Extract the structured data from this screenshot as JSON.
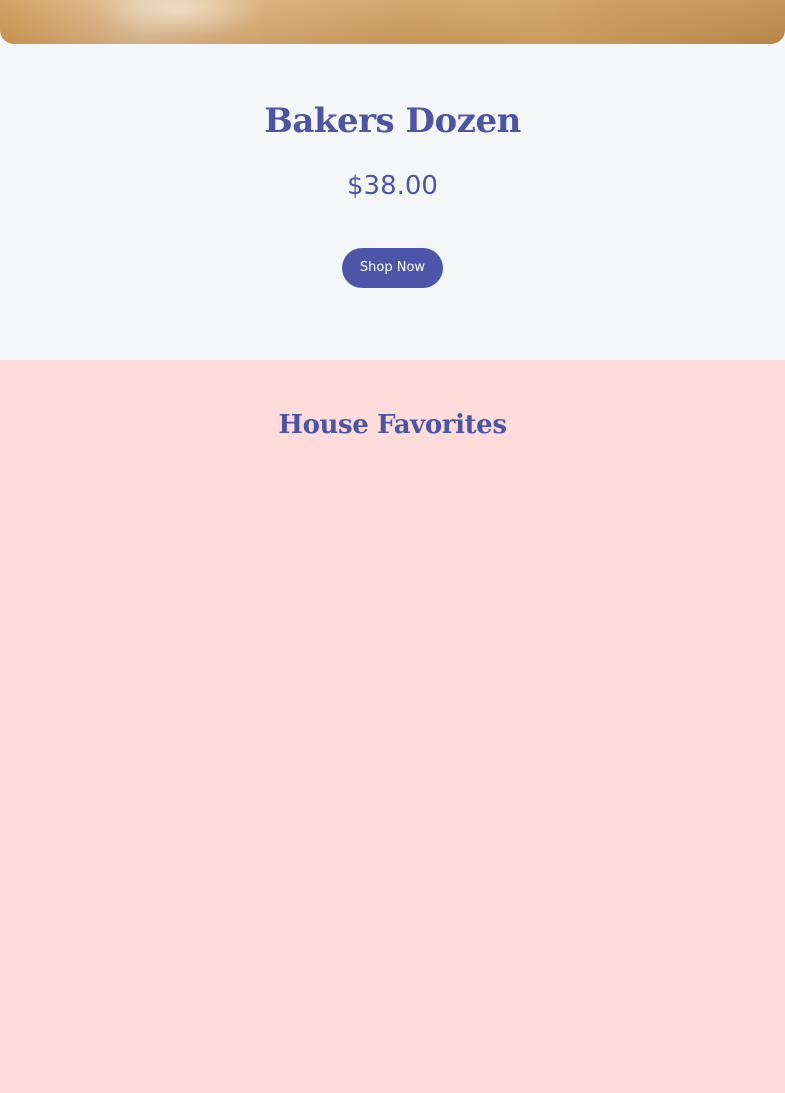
{
  "product": {
    "title": "Bakers Dozen",
    "price": "$38.00",
    "cta_label": "Shop Now"
  },
  "favorites": {
    "title": "House Favorites"
  },
  "colors": {
    "accent": "#4d55a8",
    "page_background": "#f4f6f8",
    "favorites_background": "#ffdcdc"
  }
}
